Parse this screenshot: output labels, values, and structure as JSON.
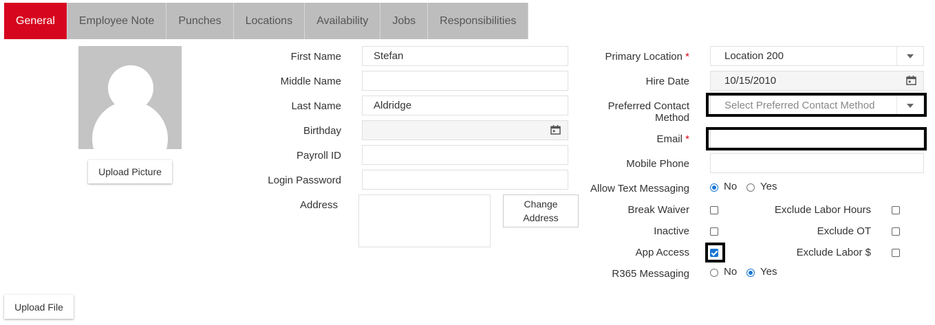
{
  "tabs": [
    {
      "label": "General",
      "active": true
    },
    {
      "label": "Employee Note"
    },
    {
      "label": "Punches"
    },
    {
      "label": "Locations"
    },
    {
      "label": "Availability"
    },
    {
      "label": "Jobs"
    },
    {
      "label": "Responsibilities"
    }
  ],
  "avatar": {
    "upload_label": "Upload Picture"
  },
  "personal": {
    "first_name_label": "First Name",
    "first_name": "Stefan",
    "middle_name_label": "Middle Name",
    "middle_name": "",
    "last_name_label": "Last Name",
    "last_name": "Aldridge",
    "birthday_label": "Birthday",
    "birthday": "",
    "payroll_label": "Payroll ID",
    "payroll": "",
    "password_label": "Login Password",
    "password": "",
    "address_label": "Address",
    "address": "",
    "change_address_line1": "Change",
    "change_address_line2": "Address"
  },
  "employment": {
    "primary_location_label": "Primary Location",
    "primary_location": "Location 200",
    "hire_date_label": "Hire Date",
    "hire_date": "10/15/2010",
    "contact_label_line1": "Preferred Contact",
    "contact_label_line2": "Method",
    "contact_placeholder": "Select Preferred Contact Method",
    "email_label": "Email",
    "email": "",
    "mobile_label": "Mobile Phone",
    "mobile": "",
    "text_label": "Allow Text Messaging",
    "text_no": "No",
    "text_yes": "Yes",
    "text_value": "No",
    "break_waiver_label": "Break Waiver",
    "break_waiver": false,
    "inactive_label": "Inactive",
    "inactive": false,
    "app_access_label": "App Access",
    "app_access": true,
    "exclude_hours_label": "Exclude Labor Hours",
    "exclude_hours": false,
    "exclude_ot_label": "Exclude OT",
    "exclude_ot": false,
    "exclude_dollar_label": "Exclude Labor $",
    "exclude_dollar": false,
    "r365_label": "R365 Messaging",
    "r365_no": "No",
    "r365_yes": "Yes",
    "r365_value": "Yes",
    "required_mark": "*"
  },
  "footer": {
    "upload_file_label": "Upload File"
  },
  "colors": {
    "accent": "#d6061f",
    "tab_bg": "#bdbdbd",
    "control_blue": "#1976d2"
  }
}
